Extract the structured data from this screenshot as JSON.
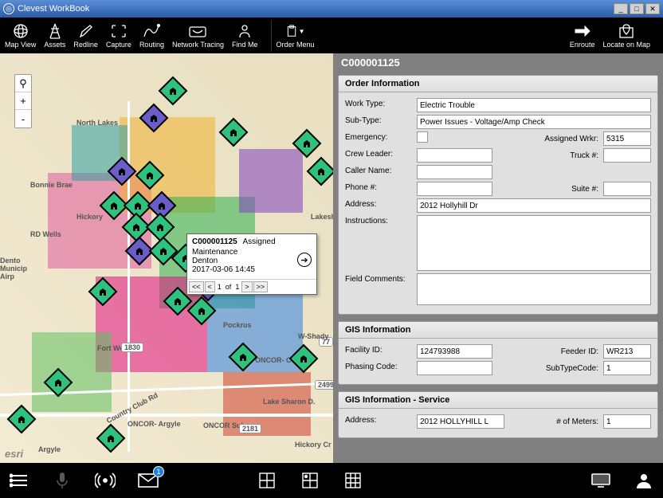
{
  "window": {
    "title": "Clevest WorkBook"
  },
  "toolbar": {
    "mapview": "Map View",
    "assets": "Assets",
    "redline": "Redline",
    "capture": "Capture",
    "routing": "Routing",
    "network": "Network Tracing",
    "findme": "Find Me",
    "ordermenu": "Order Menu",
    "enroute": "Enroute",
    "locate": "Locate on Map"
  },
  "map": {
    "labels": [
      "North Lakes",
      "Bonnie Brae",
      "Hickory",
      "RD Wells",
      "Dento Municip Airp",
      "Fort Worth",
      "ONCOR- Argyle",
      "ONCOR Sub.",
      "Argyle",
      "Hickory Cr",
      "ONCOR- Corinth",
      "Lake Sharon D.",
      "Pockrus",
      "1830",
      "77",
      "2181",
      "W-Shady",
      "esri",
      "Country Club Rd",
      "2499",
      "Lakesh"
    ],
    "popup": {
      "id": "C000001125",
      "status": "Assigned",
      "line1": "Maintenance",
      "line2": "Denton",
      "line3": "2017-03-06 14:45",
      "pager_first": "<<",
      "pager_prev": "<",
      "pager_page": "1",
      "pager_of": "of",
      "pager_total": "1",
      "pager_next": ">",
      "pager_last": ">>"
    },
    "zoom": {
      "mag": "⚲",
      "plus": "+",
      "minus": "-"
    }
  },
  "form": {
    "header": "C000001125",
    "order_info_title": "Order Information",
    "worktype_l": "Work Type:",
    "worktype": "Electric Trouble",
    "subtype_l": "Sub-Type:",
    "subtype": "Power Issues - Voltage/Amp Check",
    "emergency_l": "Emergency:",
    "assignedwrkr_l": "Assigned Wrkr:",
    "assignedwrkr": "5315",
    "crewleader_l": "Crew Leader:",
    "crewleader": "",
    "truck_l": "Truck #:",
    "truck": "",
    "caller_l": "Caller Name:",
    "caller": "",
    "phone_l": "Phone #:",
    "phone": "",
    "suite_l": "Suite #:",
    "suite": "",
    "address_l": "Address:",
    "address": "2012 Hollyhill Dr",
    "instructions_l": "Instructions:",
    "instructions": "",
    "fieldcomments_l": "Field Comments:",
    "fieldcomments": "",
    "gis_title": "GIS Information",
    "facility_l": "Facility ID:",
    "facility": "124793988",
    "feeder_l": "Feeder ID:",
    "feeder": "WR213",
    "phasing_l": "Phasing Code:",
    "phasing": "",
    "subtypecode_l": "SubTypeCode:",
    "subtypecode": "1",
    "gis_service_title": "GIS Information - Service",
    "srv_address_l": "Address:",
    "srv_address": "2012 HOLLYHILL L",
    "meters_l": "# of Meters:",
    "meters": "1"
  },
  "bottombar": {
    "badge": "1"
  }
}
